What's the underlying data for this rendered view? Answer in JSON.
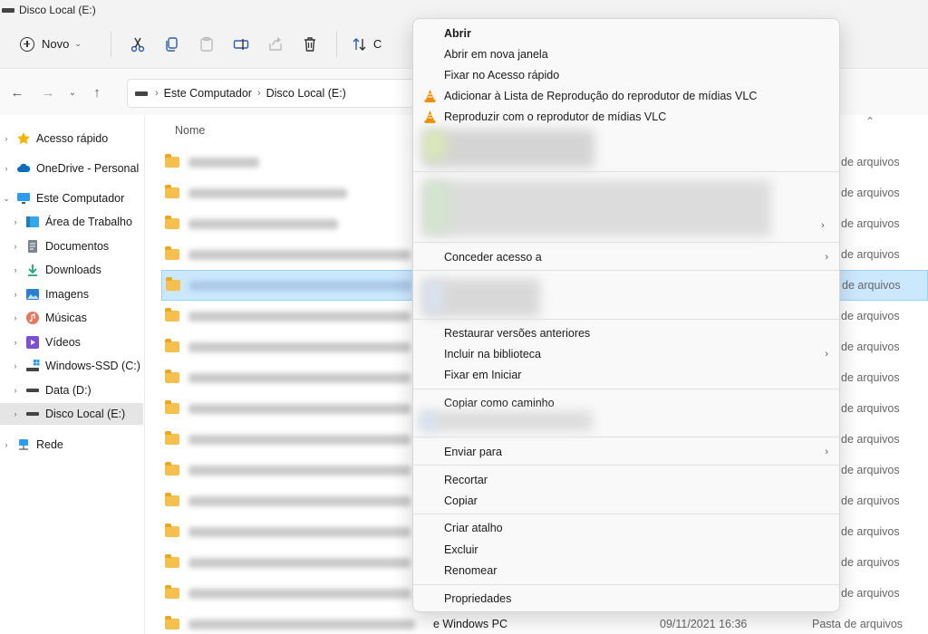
{
  "window": {
    "title": "Disco Local (E:)"
  },
  "toolbar": {
    "new_label": "Novo",
    "sort_label": "C"
  },
  "address": {
    "seg1": "Este Computador",
    "seg2": "Disco Local (E:)"
  },
  "sidebar": {
    "items": [
      {
        "label": "Acesso rápido"
      },
      {
        "label": "OneDrive - Personal"
      },
      {
        "label": "Este Computador"
      },
      {
        "label": "Área de Trabalho"
      },
      {
        "label": "Documentos"
      },
      {
        "label": "Downloads"
      },
      {
        "label": "Imagens"
      },
      {
        "label": "Músicas"
      },
      {
        "label": "Vídeos"
      },
      {
        "label": "Windows-SSD (C:)"
      },
      {
        "label": "Data (D:)"
      },
      {
        "label": "Disco Local (E:)"
      },
      {
        "label": "Rede"
      }
    ]
  },
  "content": {
    "col_name": "Nome",
    "row_type": "de arquivos",
    "last_row": {
      "name": "e Windows PC",
      "date": "09/11/2021 16:36",
      "type": "Pasta de arquivos"
    }
  },
  "menu": {
    "open": "Abrir",
    "open_new_window": "Abrir em nova janela",
    "pin_quick_access": "Fixar no Acesso rápido",
    "vlc_add": "Adicionar à Lista de Reprodução do reprodutor de mídias VLC",
    "vlc_play": "Reproduzir com o reprodutor de mídias VLC",
    "give_access": "Conceder acesso a",
    "restore_versions": "Restaurar versões anteriores",
    "include_library": "Incluir na biblioteca",
    "pin_start": "Fixar em Iniciar",
    "copy_path": "Copiar como caminho",
    "send_to": "Enviar para",
    "cut": "Recortar",
    "copy": "Copiar",
    "create_shortcut": "Criar atalho",
    "delete": "Excluir",
    "rename": "Renomear",
    "properties": "Propriedades"
  },
  "colors": {
    "accent": "#0067c0",
    "selection": "#cce8ff",
    "folder": "#f6c04e",
    "vlc": "#f08c00"
  }
}
